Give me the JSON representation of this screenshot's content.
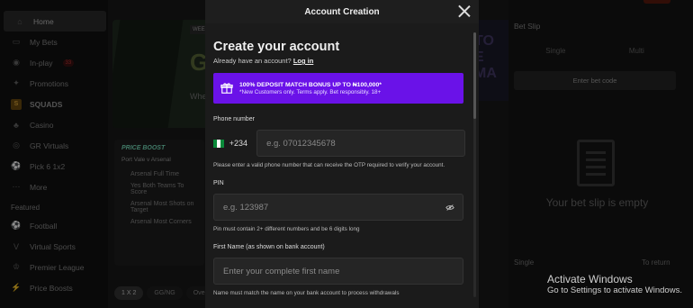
{
  "sidebar": {
    "items": [
      {
        "label": "Home",
        "icon": "home-icon",
        "glyph": "⌂"
      },
      {
        "label": "My Bets",
        "icon": "ticket-icon",
        "glyph": "▭"
      },
      {
        "label": "In-play",
        "icon": "live-icon",
        "glyph": "◉",
        "badge": "33"
      },
      {
        "label": "Promotions",
        "icon": "promotions-icon",
        "glyph": "✦"
      },
      {
        "label": "SQUADS",
        "icon": "squads-icon",
        "glyph": "S"
      },
      {
        "label": "Casino",
        "icon": "casino-icon",
        "glyph": "♣"
      },
      {
        "label": "GR Virtuals",
        "icon": "virtuals-icon",
        "glyph": "◎"
      },
      {
        "label": "Pick 6 1x2",
        "icon": "soccer-ball-icon",
        "glyph": "⚽"
      },
      {
        "label": "More",
        "icon": "more-icon",
        "glyph": "⋯"
      }
    ],
    "featured_label": "Featured",
    "featured": [
      {
        "label": "Football",
        "icon": "football-icon",
        "glyph": "⚽"
      },
      {
        "label": "Virtual Sports",
        "icon": "virtual-sports-icon",
        "glyph": "V"
      },
      {
        "label": "Premier League",
        "icon": "premier-league-icon",
        "glyph": "♔"
      },
      {
        "label": "Price Boosts",
        "icon": "price-boost-icon",
        "glyph": "⚡"
      }
    ]
  },
  "background": {
    "hero_big": "GE",
    "hero_small": "Whe",
    "hero_tag": "WEE",
    "price_boost_title": "PRICE BOOST",
    "match": "Port Vale v Arsenal",
    "boost_rows": [
      "Arsenal Full Time",
      "Yes Both Teams To Score",
      "Arsenal Most Shots on Target",
      "Arsenal Most Corners"
    ],
    "tabs": [
      "1 X 2",
      "GG/NG",
      "Over"
    ],
    "right_banner": "TO E MA"
  },
  "betslip": {
    "title": "Bet Slip",
    "tabs": [
      "Single",
      "Multi"
    ],
    "code_button": "Enter bet code",
    "empty_text": "Your bet slip is empty",
    "single_label": "Single",
    "return_label": "To return"
  },
  "os_watermark": {
    "line1": "Activate Windows",
    "line2": "Go to Settings to activate Windows."
  },
  "modal": {
    "header": "Account Creation",
    "title": "Create your account",
    "login_prompt": "Already have an account?",
    "login_link": "Log in",
    "promo_title": "100% DEPOSIT MATCH BONUS UP TO ₦100,000*",
    "promo_sub": "*New Customers only. Terms apply. Bet responsibly. 18+",
    "phone_label": "Phone number",
    "country_code": "+234",
    "phone_placeholder": "e.g. 07012345678",
    "phone_hint": "Please enter a valid phone number that can receive the OTP required to verify your account.",
    "pin_label": "PIN",
    "pin_placeholder": "e.g. 123987",
    "pin_hint": "Pin must contain 2+ different numbers and be 6 digits long",
    "first_name_label": "First Name (as shown on bank account)",
    "first_name_placeholder": "Enter your complete first name",
    "first_name_hint": "Name must match the name on your bank account to process withdrawals"
  }
}
